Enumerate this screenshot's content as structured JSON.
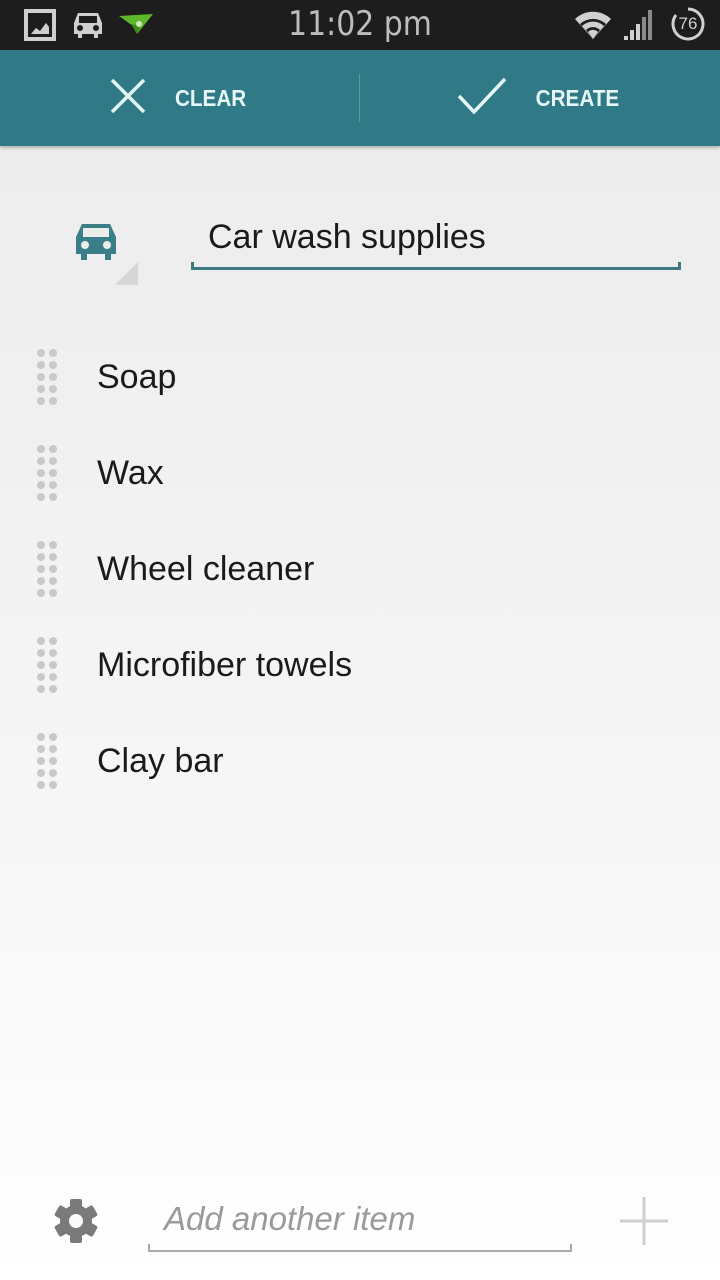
{
  "status_bar": {
    "time": "11:02 pm",
    "battery": "76",
    "left_icons": [
      "gallery-icon",
      "car-icon",
      "paper-plane-icon"
    ],
    "right_icons": [
      "wifi-icon",
      "signal-icon",
      "battery-icon"
    ]
  },
  "action_bar": {
    "clear_label": "CLEAR",
    "create_label": "CREATE",
    "accent_color": "#2f7a86"
  },
  "list_header": {
    "category_icon": "car-icon",
    "title_value": "Car wash supplies"
  },
  "items": [
    {
      "label": "Soap"
    },
    {
      "label": "Wax"
    },
    {
      "label": "Wheel cleaner"
    },
    {
      "label": "Microfiber towels"
    },
    {
      "label": "Clay bar"
    }
  ],
  "bottom_bar": {
    "add_placeholder": "Add another item",
    "settings_icon": "gear-icon",
    "add_icon": "plus-icon"
  }
}
